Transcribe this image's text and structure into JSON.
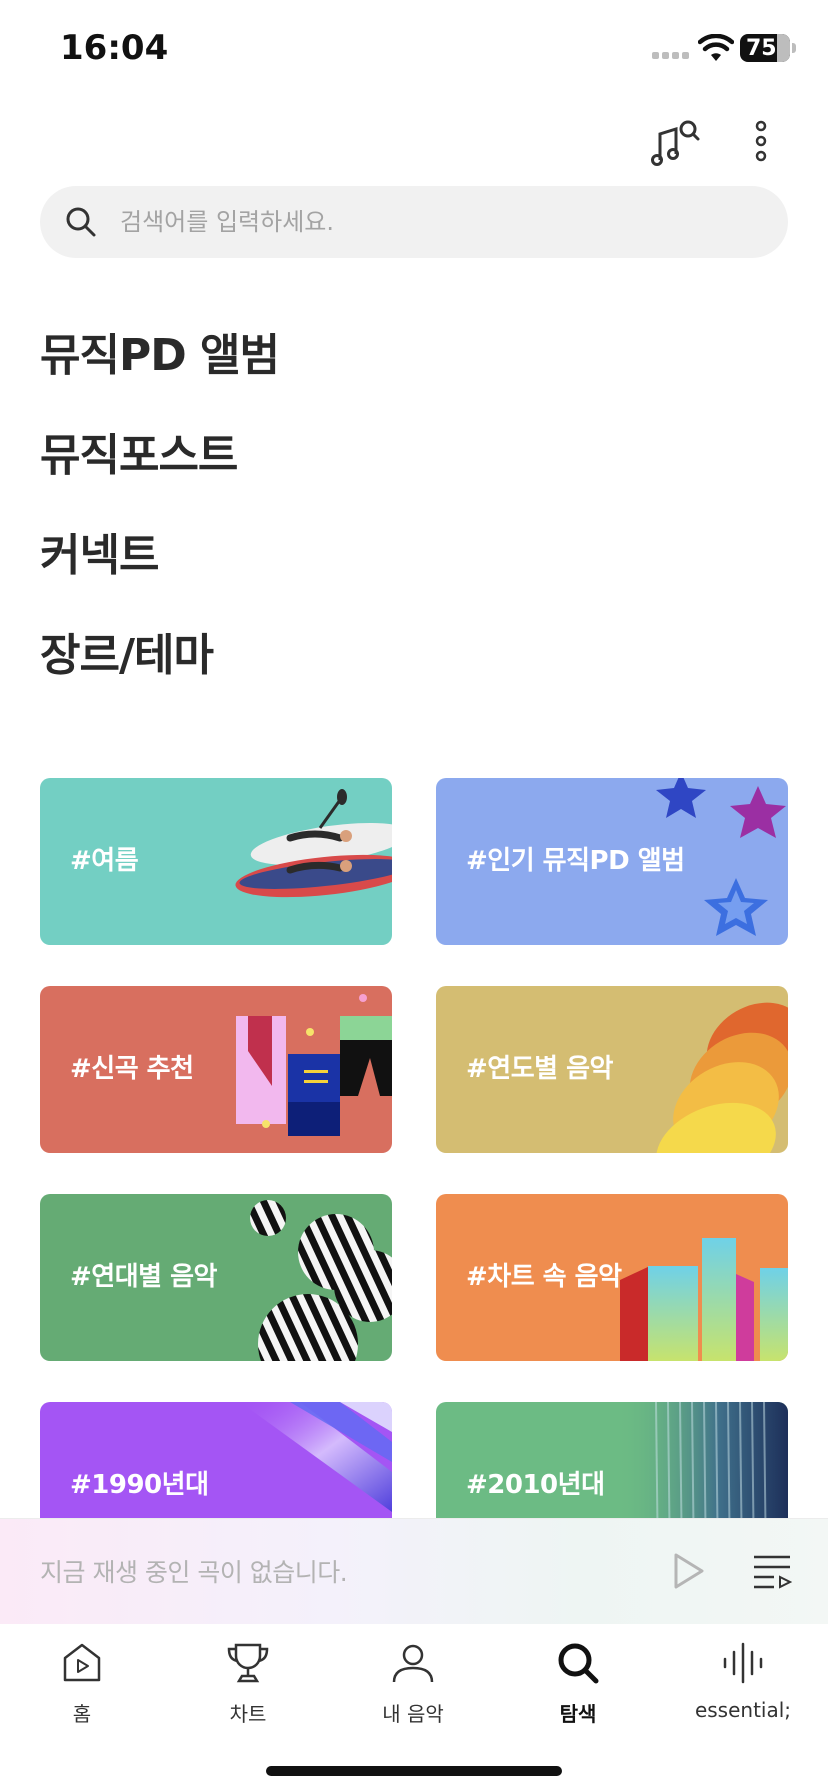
{
  "status_bar": {
    "time": "16:04",
    "battery": "75"
  },
  "search": {
    "placeholder": "검색어를 입력하세요."
  },
  "menu": {
    "items": [
      "뮤직PD 앨범",
      "뮤직포스트",
      "커넥트",
      "장르/테마"
    ]
  },
  "cards": [
    {
      "label": "#여름",
      "color": "#73cfc3"
    },
    {
      "label": "#인기 뮤직PD 앨범",
      "color": "#8ca9ee"
    },
    {
      "label": "#신곡 추천",
      "color": "#d86f5f"
    },
    {
      "label": "#연도별 음악",
      "color": "#d4bd72"
    },
    {
      "label": "#연대별 음악",
      "color": "#65ab74"
    },
    {
      "label": "#차트 속 음악",
      "color": "#ef8d4f"
    },
    {
      "label": "#1990년대",
      "color": "#a455f4"
    },
    {
      "label": "#2010년대",
      "color": "#6cbb84"
    }
  ],
  "mini_player": {
    "text": "지금 재생 중인 곡이 없습니다."
  },
  "tabs": [
    {
      "label": "홈",
      "icon": "home-play-icon"
    },
    {
      "label": "차트",
      "icon": "trophy-icon"
    },
    {
      "label": "내 음악",
      "icon": "person-icon"
    },
    {
      "label": "탐색",
      "icon": "search-icon",
      "active": true
    },
    {
      "label": "essential;",
      "icon": "soundwave-icon"
    }
  ]
}
